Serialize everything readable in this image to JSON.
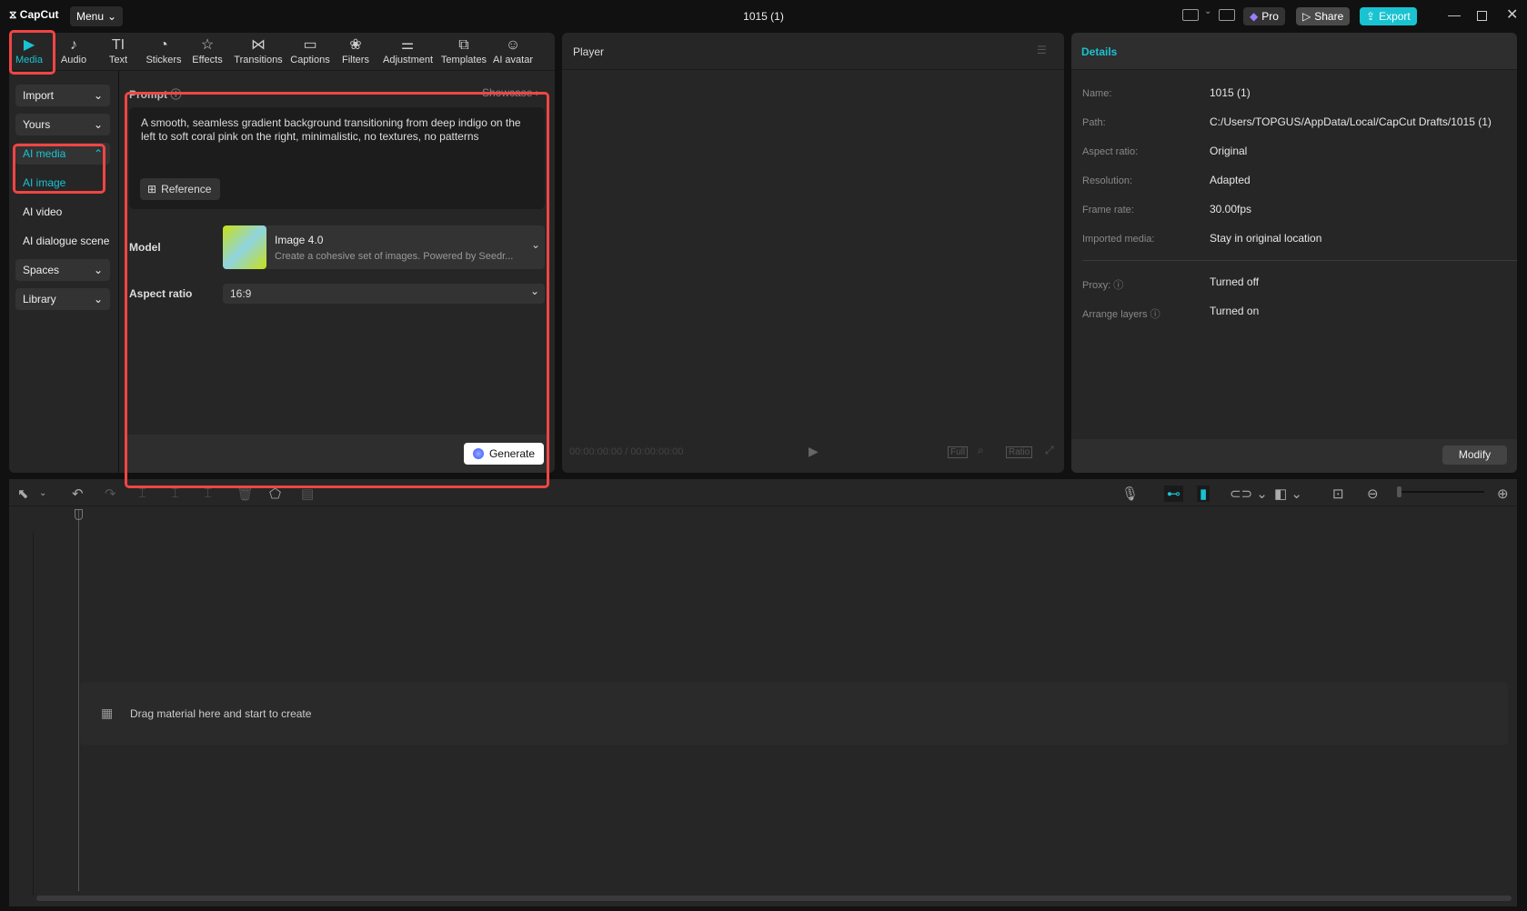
{
  "app": {
    "logo": "CapCut",
    "menu": "Menu",
    "title": "1015 (1)",
    "pro": "Pro",
    "share": "Share",
    "export": "Export",
    "accent": "#19c3d1"
  },
  "tabs": [
    {
      "label": "Media",
      "icon": "media-icon",
      "active": true
    },
    {
      "label": "Audio",
      "icon": "audio-icon"
    },
    {
      "label": "Text",
      "icon": "text-icon"
    },
    {
      "label": "Stickers",
      "icon": "sticker-icon"
    },
    {
      "label": "Effects",
      "icon": "effects-icon"
    },
    {
      "label": "Transitions",
      "icon": "transitions-icon"
    },
    {
      "label": "Captions",
      "icon": "captions-icon"
    },
    {
      "label": "Filters",
      "icon": "filters-icon"
    },
    {
      "label": "Adjustment",
      "icon": "adjustment-icon"
    },
    {
      "label": "Templates",
      "icon": "templates-icon"
    },
    {
      "label": "AI avatar",
      "icon": "ai-avatar-icon"
    }
  ],
  "sidebar": {
    "import": "Import",
    "yours": "Yours",
    "ai_media": "AI media",
    "ai_image": "AI image",
    "ai_video": "AI video",
    "ai_dialogue": "AI dialogue scene",
    "spaces": "Spaces",
    "library": "Library"
  },
  "prompt": {
    "label": "Prompt",
    "showcase": "Showcase",
    "text": "A smooth, seamless gradient background transitioning from deep indigo on the left to soft coral pink on the right, minimalistic, no textures, no patterns",
    "reference": "Reference"
  },
  "model": {
    "label": "Model",
    "name": "Image 4.0",
    "desc": "Create a cohesive set of images. Powered by Seedr..."
  },
  "aspect": {
    "label": "Aspect ratio",
    "value": "16:9"
  },
  "generate": "Generate",
  "player": {
    "title": "Player",
    "time": "00:00:00:00 / 00:00:00:00",
    "full": "Full",
    "ratio": "Ratio"
  },
  "details": {
    "title": "Details",
    "rows": [
      {
        "label": "Name:",
        "value": "1015 (1)"
      },
      {
        "label": "Path:",
        "value": "C:/Users/TOPGUS/AppData/Local/CapCut Drafts/1015 (1)"
      },
      {
        "label": "Aspect ratio:",
        "value": "Original"
      },
      {
        "label": "Resolution:",
        "value": "Adapted"
      },
      {
        "label": "Frame rate:",
        "value": "30.00fps"
      },
      {
        "label": "Imported media:",
        "value": "Stay in original location"
      }
    ],
    "proxy": {
      "label": "Proxy:",
      "value": "Turned off"
    },
    "layers": {
      "label": "Arrange layers",
      "value": "Turned on"
    },
    "modify": "Modify"
  },
  "timeline": {
    "empty": "Drag material here and start to create"
  }
}
